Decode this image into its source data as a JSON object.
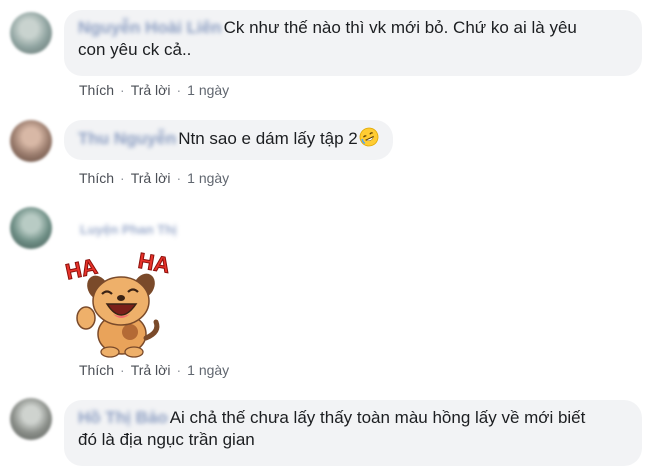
{
  "comments": [
    {
      "author": "Nguyễn Hoài Liên",
      "text_line1": "Ck như thế nào thì vk mới bỏ. Chứ ko ai là yêu",
      "text_line2": "con yêu ck cả..",
      "like": "Thích",
      "reply": "Trả lời",
      "time": "1 ngày",
      "avatar_color": "#8fa3a0"
    },
    {
      "author": "Thu Nguyễn",
      "text": "Ntn sao e dám lấy tập 2",
      "emoji": "🤣",
      "like": "Thích",
      "reply": "Trả lời",
      "time": "1 ngày",
      "avatar_color": "#9b7d6e"
    },
    {
      "author": "Luyện Phan Thị",
      "sticker_text_left": "HA",
      "sticker_text_right": "HA",
      "like": "Thích",
      "reply": "Trả lời",
      "time": "1 ngày",
      "avatar_color": "#6f8f86"
    },
    {
      "author": "Hồ Thị Bảo",
      "text_line1": "Ai chả thế chưa lấy thấy toàn màu hồng lấy về mới biết",
      "text_line2": "đó là địa ngục trần gian",
      "avatar_color": "#8b8f8a"
    }
  ],
  "icons": {
    "sticker": "laughing-dog-sticker-icon",
    "emoji": "rolling-on-floor-laughing-icon"
  }
}
